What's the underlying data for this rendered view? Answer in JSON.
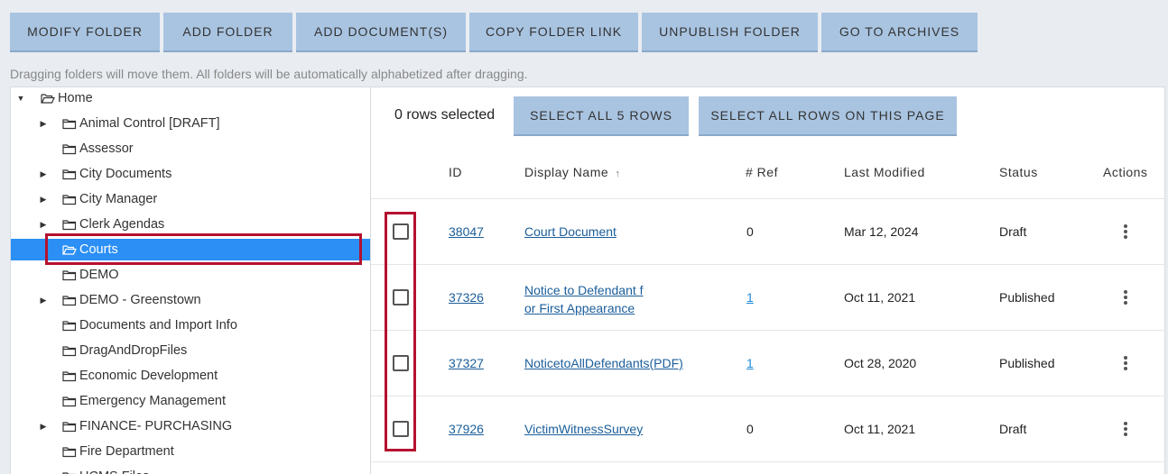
{
  "toolbar": {
    "modify_folder": "MODIFY FOLDER",
    "add_folder": "ADD FOLDER",
    "add_documents": "ADD DOCUMENT(S)",
    "copy_folder_link": "COPY FOLDER LINK",
    "unpublish_folder": "UNPUBLISH FOLDER",
    "go_to_archives": "GO TO ARCHIVES"
  },
  "hint": "Dragging folders will move them. All folders will be automatically alphabetized after dragging.",
  "tree": {
    "root": "Home",
    "items": [
      {
        "label": "Animal Control [DRAFT]",
        "expandable": true
      },
      {
        "label": "Assessor",
        "expandable": false
      },
      {
        "label": "City Documents",
        "expandable": true
      },
      {
        "label": "City Manager",
        "expandable": true
      },
      {
        "label": "Clerk Agendas",
        "expandable": true
      },
      {
        "label": "Courts",
        "expandable": false,
        "selected": true
      },
      {
        "label": "DEMO",
        "expandable": false
      },
      {
        "label": "DEMO - Greenstown",
        "expandable": true
      },
      {
        "label": "Documents and Import Info",
        "expandable": false
      },
      {
        "label": "DragAndDropFiles",
        "expandable": false
      },
      {
        "label": "Economic Development",
        "expandable": false
      },
      {
        "label": "Emergency Management",
        "expandable": false
      },
      {
        "label": "FINANCE- PURCHASING",
        "expandable": true
      },
      {
        "label": "Fire Department",
        "expandable": false
      },
      {
        "label": "HCMS Files",
        "expandable": false
      }
    ]
  },
  "grid": {
    "rows_selected": "0 rows selected",
    "select_all": "SELECT ALL 5 ROWS",
    "select_page": "SELECT ALL ROWS ON THIS PAGE",
    "headers": {
      "id": "ID",
      "display_name": "Display Name",
      "sort_icon": "↑",
      "ref": "# Ref",
      "last_modified": "Last Modified",
      "status": "Status",
      "actions": "Actions"
    },
    "rows": [
      {
        "id": "38047",
        "name_line1": "Court Document",
        "name_line2": "",
        "ref": "0",
        "ref_link": false,
        "modified": "Mar 12, 2024",
        "status": "Draft"
      },
      {
        "id": "37326",
        "name_line1": "Notice to Defendant f",
        "name_line2": "or First Appearance",
        "ref": "1",
        "ref_link": true,
        "modified": "Oct 11, 2021",
        "status": "Published"
      },
      {
        "id": "37327",
        "name_line1": "NoticetoAllDefendants(PDF)",
        "name_line2": "",
        "ref": "1",
        "ref_link": true,
        "modified": "Oct 28, 2020",
        "status": "Published"
      },
      {
        "id": "37926",
        "name_line1": "VictimWitnessSurvey",
        "name_line2": "",
        "ref": "0",
        "ref_link": false,
        "modified": "Oct 11, 2021",
        "status": "Draft"
      }
    ]
  },
  "colors": {
    "button_bg": "#a9c4e1",
    "selected_bg": "#2b8ff5",
    "highlight_border": "#b5112f",
    "link": "#1b5e9a"
  }
}
